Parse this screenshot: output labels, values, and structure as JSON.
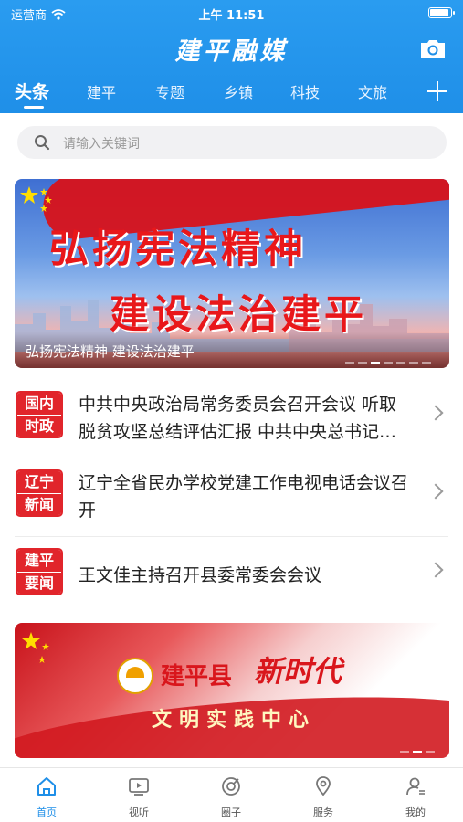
{
  "status_bar": {
    "carrier": "运营商",
    "time": "上午 11:51"
  },
  "header": {
    "app_title": "建平融媒",
    "tabs": [
      {
        "label": "头条",
        "active": true
      },
      {
        "label": "建平",
        "active": false
      },
      {
        "label": "专题",
        "active": false
      },
      {
        "label": "乡镇",
        "active": false
      },
      {
        "label": "科技",
        "active": false
      },
      {
        "label": "文旅",
        "active": false
      }
    ]
  },
  "search": {
    "placeholder": "请输入关键词"
  },
  "banner1": {
    "line1": "弘扬宪法精神",
    "line2": "建设法治建平",
    "caption": "弘扬宪法精神 建设法治建平"
  },
  "news": [
    {
      "badge_line1": "国内",
      "badge_line2": "时政",
      "title": "中共中央政治局常务委员会召开会议 听取脱贫攻坚总结评估汇报 中共中央总书记习近平主持会议"
    },
    {
      "badge_line1": "辽宁",
      "badge_line2": "新闻",
      "title": "辽宁全省民办学校党建工作电视电话会议召开"
    },
    {
      "badge_line1": "建平",
      "badge_line2": "要闻",
      "title": "王文佳主持召开县委常委会会议"
    }
  ],
  "banner2": {
    "logo_text": "文明实践",
    "county": "建平县",
    "era": "新时代",
    "center": "文明实践中心"
  },
  "bottom_nav": [
    {
      "label": "首页",
      "icon": "home-icon",
      "active": true
    },
    {
      "label": "视听",
      "icon": "video-icon",
      "active": false
    },
    {
      "label": "圈子",
      "icon": "circle-icon",
      "active": false
    },
    {
      "label": "服务",
      "icon": "location-icon",
      "active": false
    },
    {
      "label": "我的",
      "icon": "user-icon",
      "active": false
    }
  ],
  "colors": {
    "primary": "#1f8fe8",
    "badge_red": "#e1252b",
    "banner_red": "#e9171a"
  }
}
